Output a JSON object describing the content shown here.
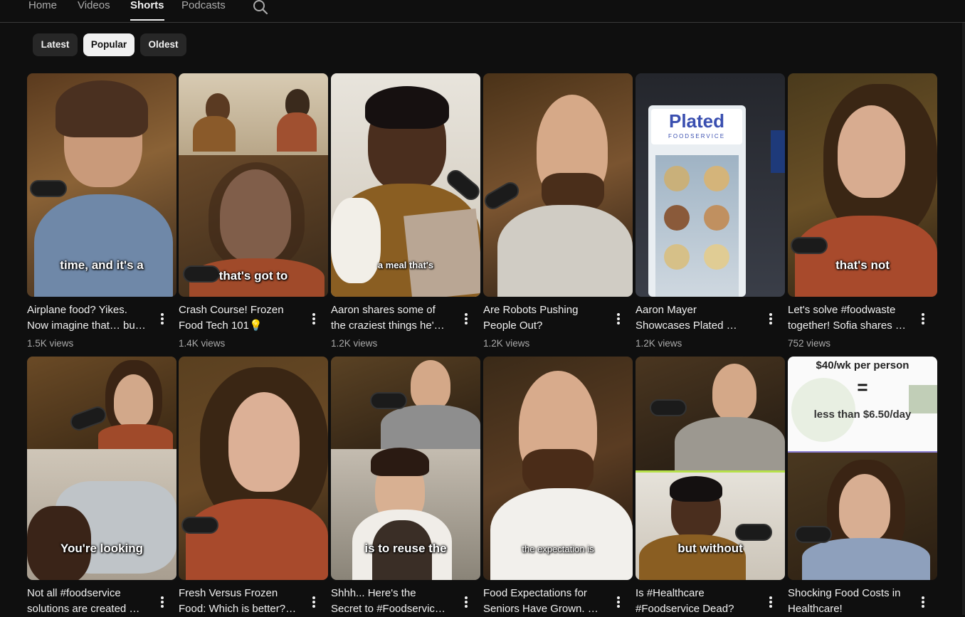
{
  "nav": {
    "tabs": [
      {
        "label": "Home"
      },
      {
        "label": "Videos"
      },
      {
        "label": "Shorts"
      },
      {
        "label": "Podcasts"
      }
    ],
    "search_icon": "search-icon"
  },
  "filters": [
    {
      "label": "Latest"
    },
    {
      "label": "Popular"
    },
    {
      "label": "Oldest"
    }
  ],
  "shorts": [
    {
      "title1": "Airplane food? Yikes.",
      "title2": "Now imagine that… bu…",
      "views": "1.5K views",
      "caption": "time, and it's a"
    },
    {
      "title1": "Crash Course! Frozen",
      "title2": "Food Tech 101💡",
      "views": "1.4K views",
      "caption": "that's got to"
    },
    {
      "title1": "Aaron shares some of",
      "title2": "the craziest things he'…",
      "views": "1.2K views",
      "caption": "a meal that's"
    },
    {
      "title1": "Are Robots Pushing",
      "title2": "People Out?",
      "views": "1.2K views",
      "caption": ""
    },
    {
      "title1": "Aaron Mayer",
      "title2": "Showcases Plated …",
      "views": "1.2K views",
      "caption": "",
      "sign_brand": "Plated",
      "sign_sub": "FOODSERVICE"
    },
    {
      "title1": "Let's solve #foodwaste",
      "title2": "together! Sofia shares …",
      "views": "752 views",
      "caption": "that's not"
    },
    {
      "title1": "Not all #foodservice",
      "title2": "solutions are created …",
      "views": "",
      "caption": "You're looking"
    },
    {
      "title1": "Fresh Versus Frozen",
      "title2": "Food: Which is better?…",
      "views": "",
      "caption": ""
    },
    {
      "title1": "Shhh... Here's the",
      "title2": "Secret to #Foodservic…",
      "views": "",
      "caption": "is to reuse the"
    },
    {
      "title1": "Food Expectations for",
      "title2": "Seniors Have Grown. …",
      "views": "",
      "caption": "the expectation is"
    },
    {
      "title1": "Is #Healthcare",
      "title2": "#Foodservice Dead?",
      "views": "",
      "caption": "but without"
    },
    {
      "title1": "Shocking Food Costs in",
      "title2": "Healthcare!",
      "views": "",
      "caption": "",
      "overlay1": "$40/wk per person",
      "overlay2": "=",
      "overlay3": "less than $6.50/day"
    }
  ]
}
